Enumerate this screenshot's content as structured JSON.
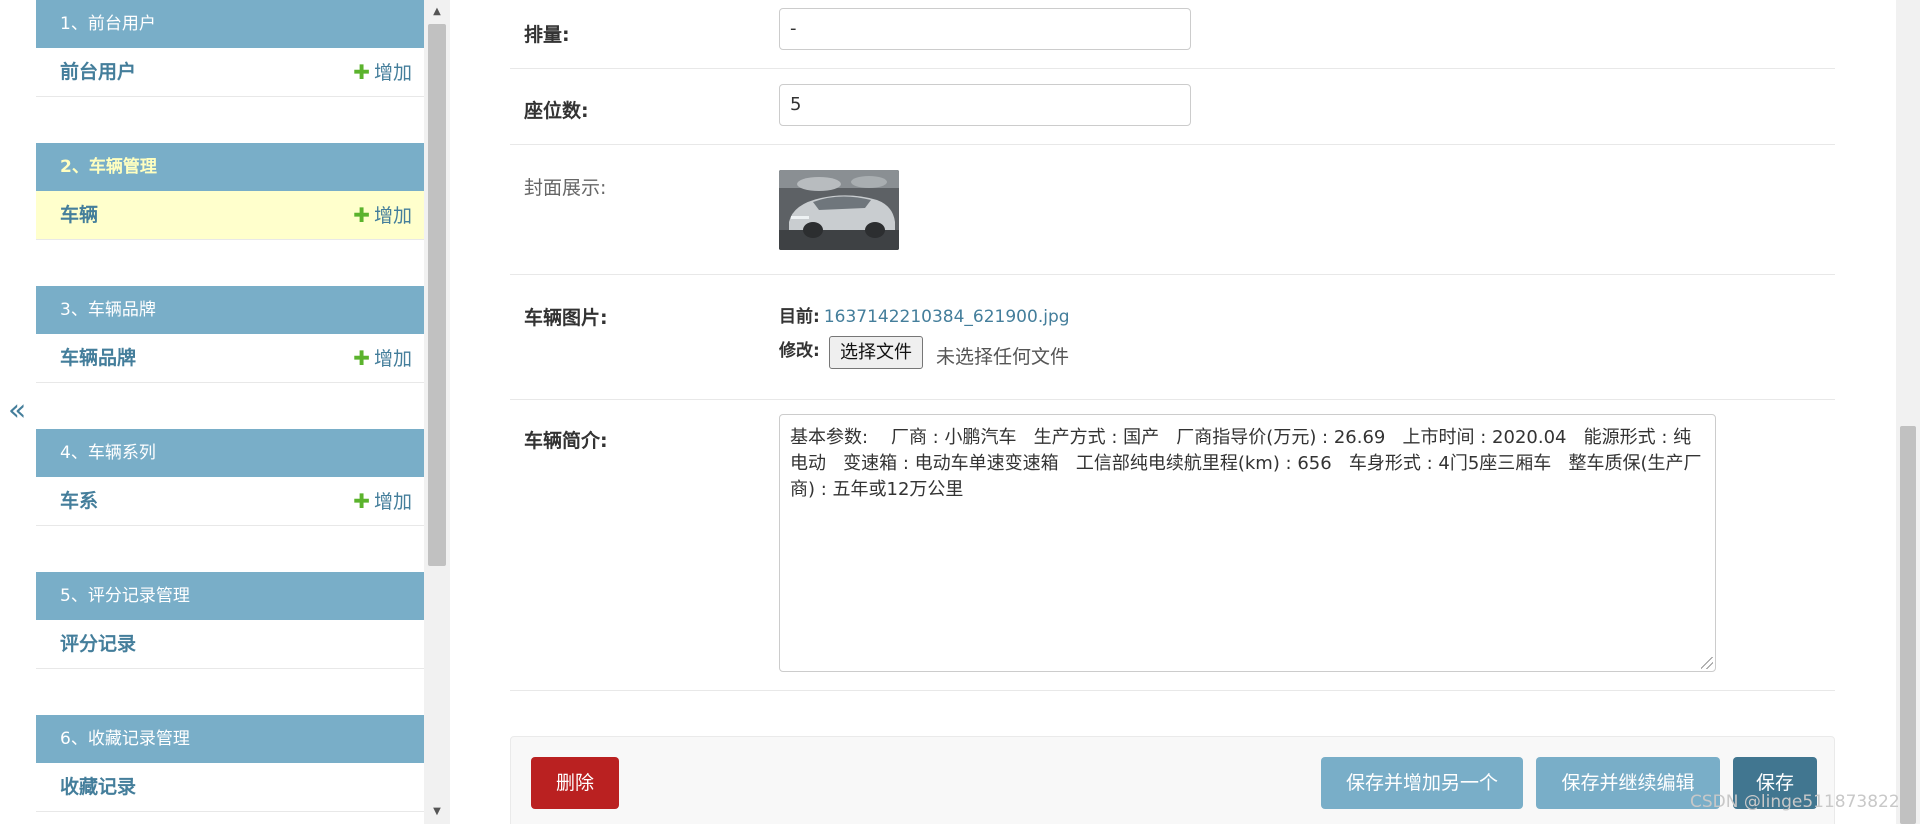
{
  "collapse_toggle": {
    "glyph": "«"
  },
  "sidebar": {
    "modules": [
      {
        "header": "1、前台用户",
        "model": "前台用户",
        "add": "增加"
      },
      {
        "header": "2、车辆管理",
        "model": "车辆",
        "add": "增加"
      },
      {
        "header": "3、车辆品牌",
        "model": "车辆品牌",
        "add": "增加"
      },
      {
        "header": "4、车辆系列",
        "model": "车系",
        "add": "增加"
      },
      {
        "header": "5、评分记录管理",
        "model": "评分记录"
      },
      {
        "header": "6、收藏记录管理",
        "model": "收藏记录"
      }
    ],
    "add_icon": "plus-icon",
    "scroll_up": "▲",
    "scroll_down": "▼"
  },
  "form": {
    "displacement": {
      "label": "排量:",
      "value": "-"
    },
    "seats": {
      "label": "座位数:",
      "value": "5"
    },
    "cover": {
      "label": "封面展示:"
    },
    "vehicle_image": {
      "label": "车辆图片:",
      "current_label": "目前:",
      "current_file": "1637142210384_621900.jpg",
      "change_label": "修改:",
      "choose_button": "选择文件",
      "no_file_text": "未选择任何文件"
    },
    "intro": {
      "label": "车辆简介:",
      "value": "基本参数:    厂商 : 小鹏汽车   生产方式 : 国产   厂商指导价(万元) : 26.69   上市时间 : 2020.04   能源形式 : 纯电动   变速箱 : 电动车单速变速箱   工信部纯电续航里程(km) : 656   车身形式 : 4门5座三厢车   整车质保(生产厂商) : 五年或12万公里"
    }
  },
  "submit_row": {
    "delete": "删除",
    "save_add_another": "保存并增加另一个",
    "save_continue": "保存并继续编辑",
    "save": "保存"
  },
  "watermark": "CSDN @linge511873822",
  "colors": {
    "module_header": "#79aec8",
    "link": "#447e9b",
    "add_plus": "#5bb32d",
    "current_row": "#ffffcc",
    "delete": "#ba2121",
    "save": "#417690"
  }
}
